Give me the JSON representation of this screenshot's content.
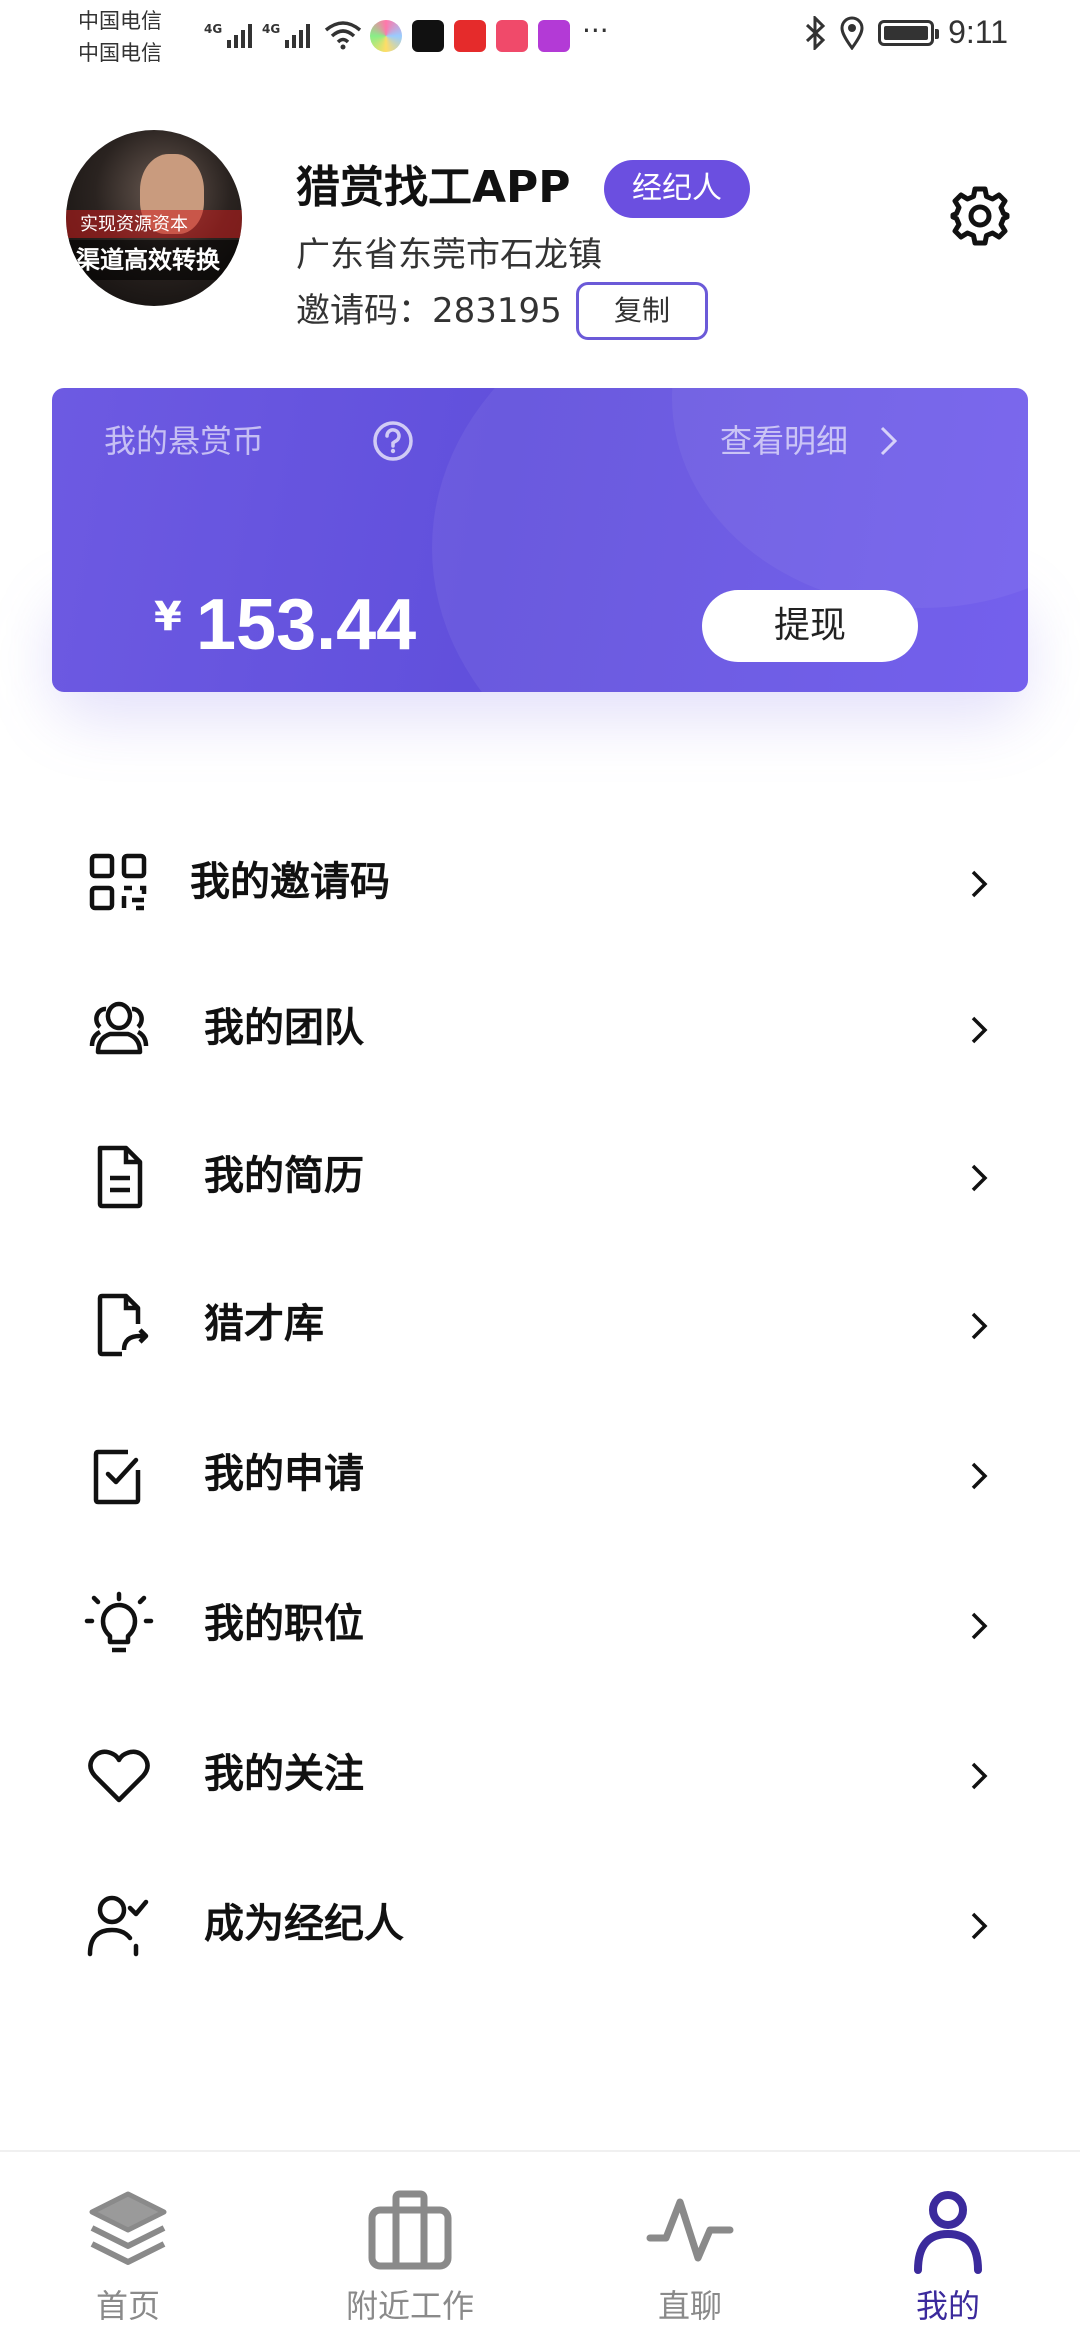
{
  "status_bar": {
    "carrier_1": "中国电信",
    "carrier_2": "中国电信",
    "network_1": "4G",
    "network_2": "4G",
    "more": "···",
    "time": "9:11",
    "icons": [
      "signal-icon",
      "wifi-icon",
      "bluetooth-icon",
      "location-icon",
      "battery-icon"
    ]
  },
  "profile": {
    "avatar_text_1": "实现资源资本",
    "avatar_text_2": "渠道高效转换",
    "name": "猎赏找工APP",
    "role_badge": "经纪人",
    "location": "广东省东莞市石龙镇",
    "invite_code_line": "邀请码：283195",
    "copy_label": "复制"
  },
  "wallet": {
    "label": "我的悬赏币",
    "detail_link": "查看明细",
    "currency_symbol": "¥",
    "balance": "153.44",
    "withdraw_label": "提现"
  },
  "menu": {
    "items": [
      {
        "label": "我的邀请码",
        "icon": "qr-code-icon"
      },
      {
        "label": "我的团队",
        "icon": "team-icon"
      },
      {
        "label": "我的简历",
        "icon": "resume-icon"
      },
      {
        "label": "猎才库",
        "icon": "talent-pool-icon"
      },
      {
        "label": "我的申请",
        "icon": "checkbox-icon"
      },
      {
        "label": "我的职位",
        "icon": "lightbulb-icon"
      },
      {
        "label": "我的关注",
        "icon": "heart-icon"
      },
      {
        "label": "成为经纪人",
        "icon": "user-check-icon"
      }
    ]
  },
  "tab_bar": {
    "tabs": [
      {
        "label": "首页",
        "icon": "layers-icon"
      },
      {
        "label": "附近工作",
        "icon": "briefcase-icon"
      },
      {
        "label": "直聊",
        "icon": "pulse-icon"
      },
      {
        "label": "我的",
        "icon": "person-icon",
        "active": true
      }
    ]
  },
  "colors": {
    "accent": "#6b4fe0",
    "card_start": "#6d5ae2",
    "card_end": "#6c57ec",
    "active_tab": "#3b2a9c",
    "inactive_tab": "#8a8a8a"
  }
}
